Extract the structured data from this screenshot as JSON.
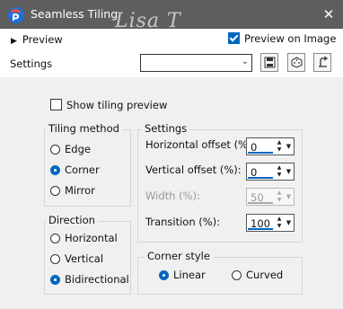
{
  "window": {
    "title": "Seamless Tiling",
    "watermark": "Lisa T",
    "close_icon": "close-icon"
  },
  "top": {
    "preview_label": "Preview",
    "preview_on_image_label": "Preview on Image",
    "preview_on_image_checked": true,
    "settings_label": "Settings",
    "settings_value": ""
  },
  "show_tiling_preview": {
    "label": "Show tiling preview",
    "checked": false
  },
  "tiling_method": {
    "label": "Tiling method",
    "options": [
      "Edge",
      "Corner",
      "Mirror"
    ],
    "selected": "Corner"
  },
  "direction": {
    "label": "Direction",
    "options": [
      "Horizontal",
      "Vertical",
      "Bidirectional"
    ],
    "selected": "Bidirectional"
  },
  "settings": {
    "label": "Settings",
    "fields": [
      {
        "label": "Horizontal offset (%):",
        "value": "0",
        "enabled": true
      },
      {
        "label": "Vertical offset (%):",
        "value": "0",
        "enabled": true
      },
      {
        "label": "Width (%):",
        "value": "50",
        "enabled": false
      },
      {
        "label": "Transition (%):",
        "value": "100",
        "enabled": true
      }
    ]
  },
  "corner_style": {
    "label": "Corner style",
    "options": [
      "Linear",
      "Curved"
    ],
    "selected": "Linear"
  },
  "colors": {
    "accent": "#0067c0",
    "titlebar": "#5e5e5e"
  }
}
